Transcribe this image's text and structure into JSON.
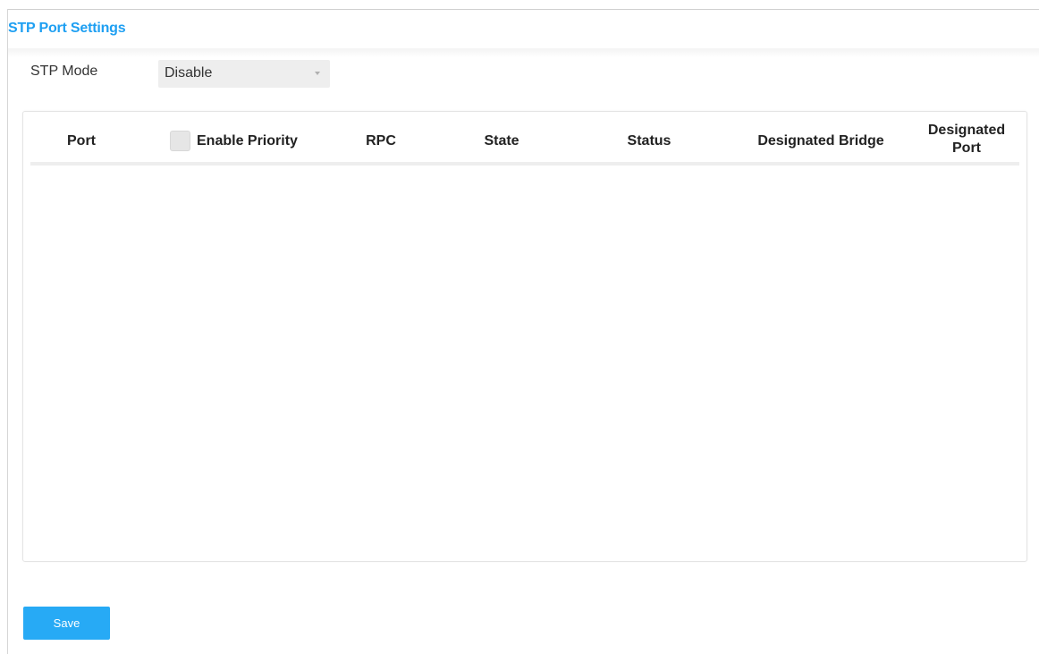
{
  "page": {
    "title": "STP Port Settings"
  },
  "stp_mode": {
    "label": "STP Mode",
    "selected": "Disable"
  },
  "table": {
    "headers": {
      "port": "Port",
      "enable_priority": "Enable Priority",
      "rpc": "RPC",
      "state": "State",
      "status": "Status",
      "designated_bridge": "Designated Bridge",
      "designated_port": "Designated\nPort"
    },
    "rows": []
  },
  "actions": {
    "save_label": "Save"
  },
  "colors": {
    "accent": "#1e9ff2",
    "button": "#27aaf5"
  }
}
